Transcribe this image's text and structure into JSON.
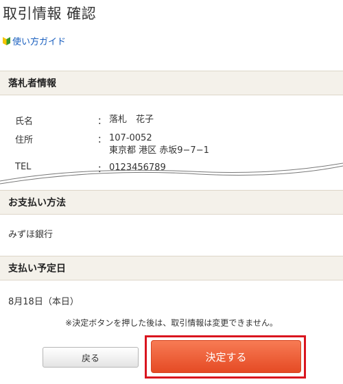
{
  "page": {
    "title": "取引情報 確認"
  },
  "guide": {
    "label": "使い方ガイド"
  },
  "winner": {
    "header": "落札者情報",
    "name": {
      "label": "氏名",
      "sep": "：",
      "value": "落札　花子"
    },
    "address": {
      "label": "住所",
      "sep": "：",
      "postal": "107-0052",
      "street": "東京都 港区 赤坂9−7−1"
    },
    "tel": {
      "label": "TEL",
      "sep": "：",
      "value": "0123456789"
    }
  },
  "payment": {
    "header": "お支払い方法",
    "value": "みずほ銀行"
  },
  "schedule": {
    "header": "支払い予定日",
    "value": "8月18日（本日）"
  },
  "notice": "※決定ボタンを押した後は、取引情報は変更できません。",
  "buttons": {
    "back": "戻る",
    "confirm": "決定する"
  },
  "colors": {
    "accent": "#e54a24",
    "highlight_frame": "#d9141e",
    "link": "#1a5fbf",
    "section_bg": "#f4f1ea"
  }
}
